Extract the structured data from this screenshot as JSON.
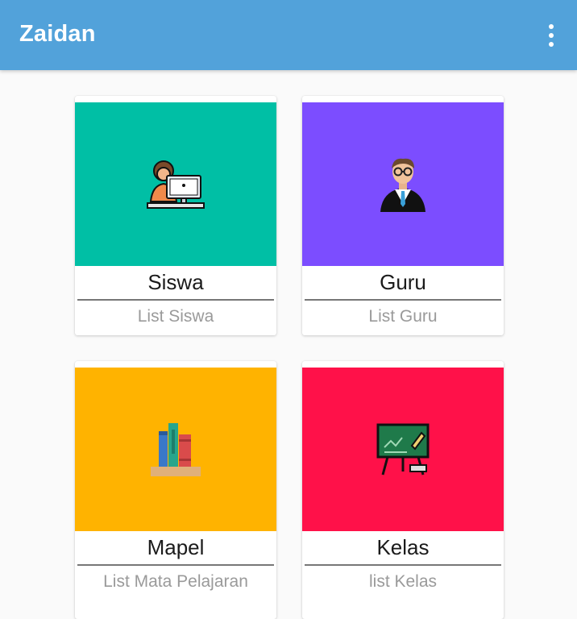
{
  "app_bar": {
    "title": "Zaidan",
    "menu_icon": "more-vert-icon"
  },
  "cards": [
    {
      "key": "siswa",
      "title": "Siswa",
      "subtitle": "List Siswa",
      "color": "#00bfa5",
      "icon": "student-computer-icon"
    },
    {
      "key": "guru",
      "title": "Guru",
      "subtitle": "List Guru",
      "color": "#7c4dff",
      "icon": "teacher-icon"
    },
    {
      "key": "mapel",
      "title": "Mapel",
      "subtitle": "List Mata Pelajaran",
      "color": "#ffb300",
      "icon": "books-icon"
    },
    {
      "key": "kelas",
      "title": "Kelas",
      "subtitle": "list Kelas",
      "color": "#ff1149",
      "icon": "blackboard-icon"
    }
  ]
}
